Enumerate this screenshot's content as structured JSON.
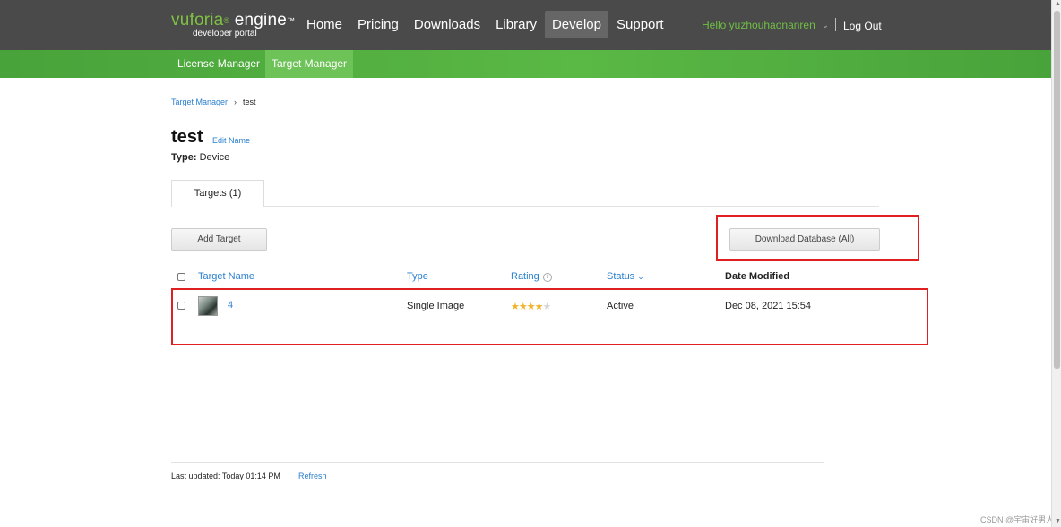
{
  "logo": {
    "brand_prefix": "vuforia",
    "brand_mark": "®",
    "brand_suffix": " engine",
    "brand_tm": "™",
    "subtitle": "developer portal"
  },
  "nav": {
    "items": [
      "Home",
      "Pricing",
      "Downloads",
      "Library",
      "Develop",
      "Support"
    ],
    "active": "Develop"
  },
  "user": {
    "greeting": "Hello yuzhouhaonanren",
    "logout": "Log Out"
  },
  "subnav": {
    "license_manager": "License Manager",
    "target_manager": "Target Manager"
  },
  "breadcrumb": {
    "root": "Target Manager",
    "current": "test"
  },
  "database": {
    "name": "test",
    "edit_link": "Edit Name",
    "type_label": "Type:",
    "type_value": "Device"
  },
  "tabs": {
    "targets": "Targets (1)"
  },
  "buttons": {
    "add_target": "Add Target",
    "download_database": "Download Database (All)"
  },
  "table": {
    "headers": {
      "name": "Target Name",
      "type": "Type",
      "rating": "Rating",
      "rating_info": "i",
      "status": "Status",
      "status_sort": "⌄",
      "date": "Date Modified"
    },
    "rows": [
      {
        "name": "4",
        "type": "Single Image",
        "rating": 4,
        "rating_max": 5,
        "status": "Active",
        "date": "Dec 08, 2021 15:54"
      }
    ]
  },
  "footer": {
    "updated": "Last updated: Today 01:14 PM",
    "refresh": "Refresh"
  },
  "watermark": "CSDN @宇宙好男人",
  "colors": {
    "topbar": "#4a4a4a",
    "green": "#5ab845",
    "link": "#2a7fcf",
    "highlight_box": "#e02020",
    "star": "#f0b429"
  }
}
